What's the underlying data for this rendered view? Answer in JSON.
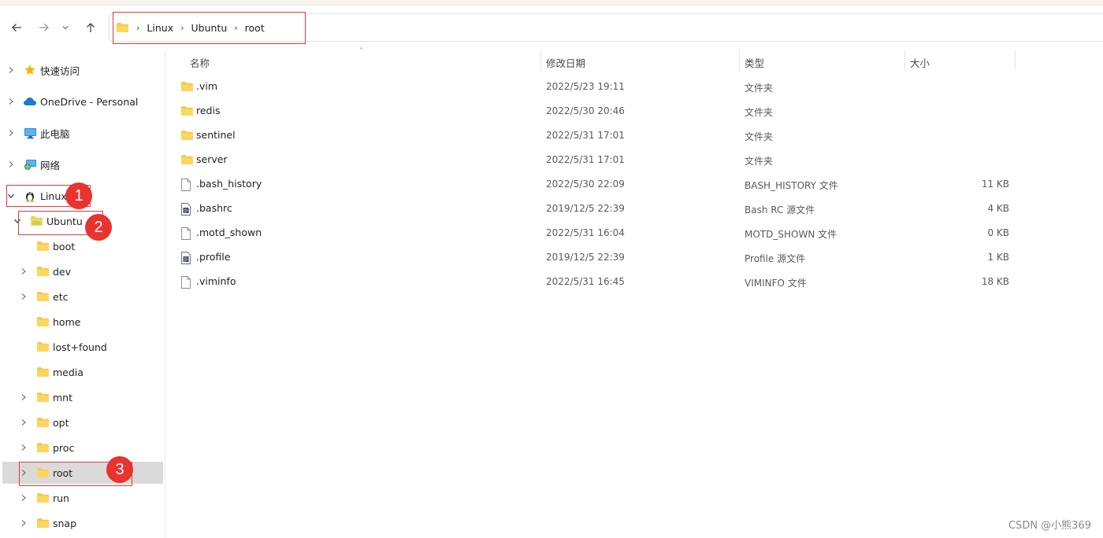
{
  "address": {
    "crumbs": [
      "Linux",
      "Ubuntu",
      "root"
    ]
  },
  "sidebar": {
    "items": [
      {
        "label": "快速访问",
        "icon": "star-icon"
      },
      {
        "label": "OneDrive - Personal",
        "icon": "cloud-icon"
      },
      {
        "label": "此电脑",
        "icon": "computer-icon"
      },
      {
        "label": "网络",
        "icon": "network-icon"
      },
      {
        "label": "Linux",
        "icon": "linux-penguin-icon"
      },
      {
        "label": "Ubuntu",
        "icon": "folder-icon"
      },
      {
        "label": "boot",
        "icon": "folder-icon"
      },
      {
        "label": "dev",
        "icon": "folder-icon"
      },
      {
        "label": "etc",
        "icon": "folder-icon"
      },
      {
        "label": "home",
        "icon": "folder-icon"
      },
      {
        "label": "lost+found",
        "icon": "folder-icon"
      },
      {
        "label": "media",
        "icon": "folder-icon"
      },
      {
        "label": "mnt",
        "icon": "folder-icon"
      },
      {
        "label": "opt",
        "icon": "folder-icon"
      },
      {
        "label": "proc",
        "icon": "folder-icon"
      },
      {
        "label": "root",
        "icon": "folder-icon"
      },
      {
        "label": "run",
        "icon": "folder-icon"
      },
      {
        "label": "snap",
        "icon": "folder-icon"
      }
    ]
  },
  "badges": [
    "1",
    "2",
    "3"
  ],
  "columns": {
    "name": "名称",
    "date": "修改日期",
    "type": "类型",
    "size": "大小"
  },
  "files": [
    {
      "name": ".vim",
      "date": "2022/5/23 19:11",
      "type": "文件夹",
      "size": "",
      "icon": "folder-icon"
    },
    {
      "name": "redis",
      "date": "2022/5/30 20:46",
      "type": "文件夹",
      "size": "",
      "icon": "folder-icon"
    },
    {
      "name": "sentinel",
      "date": "2022/5/31 17:01",
      "type": "文件夹",
      "size": "",
      "icon": "folder-icon"
    },
    {
      "name": "server",
      "date": "2022/5/31 17:01",
      "type": "文件夹",
      "size": "",
      "icon": "folder-icon"
    },
    {
      "name": ".bash_history",
      "date": "2022/5/30 22:09",
      "type": "BASH_HISTORY 文件",
      "size": "11 KB",
      "icon": "file-icon"
    },
    {
      "name": ".bashrc",
      "date": "2019/12/5 22:39",
      "type": "Bash RC 源文件",
      "size": "4 KB",
      "icon": "script-file-icon"
    },
    {
      "name": ".motd_shown",
      "date": "2022/5/31 16:04",
      "type": "MOTD_SHOWN 文件",
      "size": "0 KB",
      "icon": "file-icon"
    },
    {
      "name": ".profile",
      "date": "2019/12/5 22:39",
      "type": "Profile 源文件",
      "size": "1 KB",
      "icon": "script-file-icon"
    },
    {
      "name": ".viminfo",
      "date": "2022/5/31 16:45",
      "type": "VIMINFO 文件",
      "size": "18 KB",
      "icon": "file-icon"
    }
  ],
  "watermark": "CSDN @小熊369",
  "colors": {
    "folder": "#f7c948",
    "badge": "#e8332f",
    "highlight_box": "#e03a3a",
    "selected_row": "#dadada"
  }
}
